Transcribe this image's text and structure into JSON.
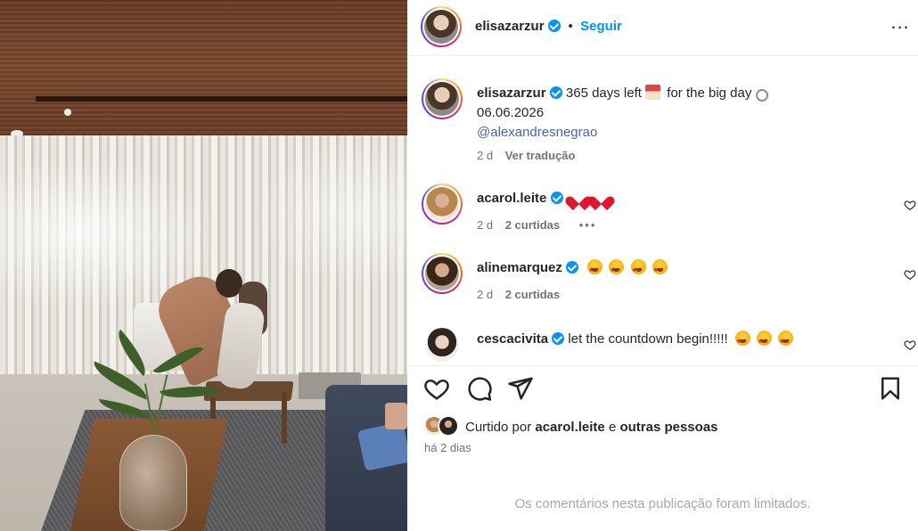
{
  "header": {
    "username": "elisazarzur",
    "follow_label": "Seguir",
    "separator": "•",
    "more_label": "..."
  },
  "caption": {
    "username": "elisazarzur",
    "text_part1": "365 days left",
    "text_part2": "for the big day",
    "date_line": "06.06.2026",
    "mention": "@alexandresnegrao",
    "time": "2 d",
    "translate_label": "Ver tradução"
  },
  "comments": [
    {
      "username": "acarol.leite",
      "emojis": [
        "red-heart",
        "red-heart"
      ],
      "time": "2 d",
      "likes": "2 curtidas",
      "more": "•••"
    },
    {
      "username": "alinemarquez",
      "emojis": [
        "star-struck",
        "star-struck",
        "star-struck",
        "star-struck"
      ],
      "time": "2 d",
      "likes": "2 curtidas"
    },
    {
      "username": "cescacivita",
      "text": "let the countdown begin!!!!!",
      "emojis": [
        "star-struck",
        "star-struck",
        "star-struck"
      ]
    }
  ],
  "likes": {
    "prefix": "Curtido por",
    "user": "acarol.leite",
    "conj": "e",
    "others": "outras pessoas"
  },
  "date": "há 2 dias",
  "limited_notice": "Os comentários nesta publicação foram limitados.",
  "colors": {
    "accent": "#0095f6",
    "link": "#4a5ec5",
    "muted": "#737373",
    "text": "#262626"
  },
  "icons": [
    "more-icon",
    "verified-icon",
    "heart-icon",
    "comment-icon",
    "share-icon",
    "bookmark-icon"
  ]
}
